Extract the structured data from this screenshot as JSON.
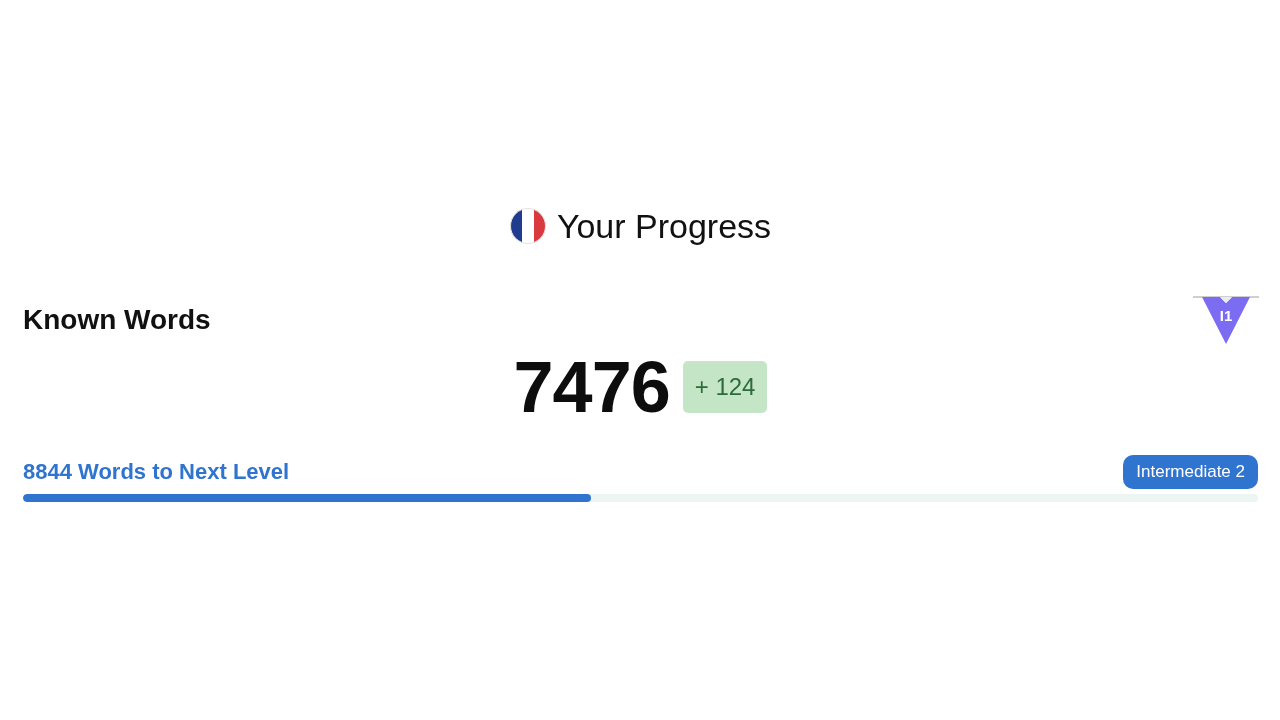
{
  "header": {
    "title": "Your Progress"
  },
  "known_words": {
    "label": "Known Words",
    "level_badge": "I1",
    "count": "7476",
    "gain": "+ 124"
  },
  "next_level": {
    "label": "8844 Words to Next Level",
    "target": "Intermediate 2",
    "level": 0.46
  }
}
